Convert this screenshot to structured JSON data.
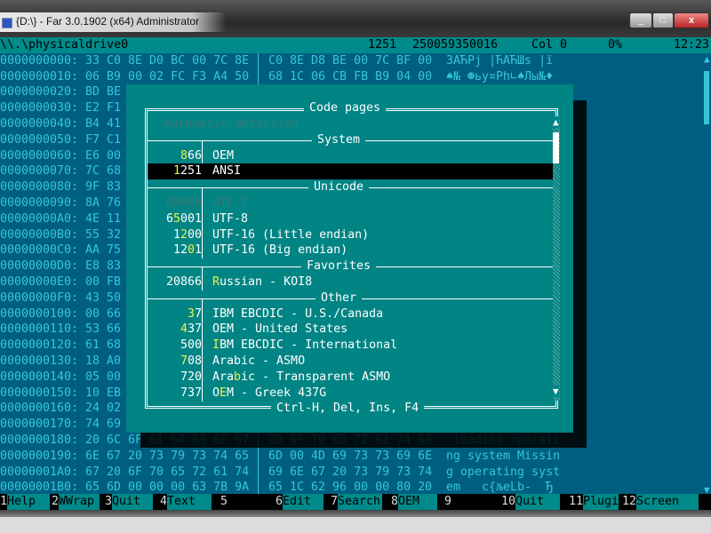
{
  "window": {
    "title": "{D:\\} - Far 3.0.1902 (x64) Administrator",
    "controls": [
      "minimize",
      "maximize",
      "close"
    ]
  },
  "status": {
    "path": "\\\\.\\physicaldrive0",
    "codepage": "1251",
    "size": "250059350016",
    "col": "Col 0",
    "percent": "0%",
    "time": "12:23"
  },
  "hex_rows": [
    {
      "offset": "0000000000:",
      "left": "33 C0 8E D0 BC 00 7C 8E",
      "right": "C0 8E D8 BE 00 7C BF 00",
      "text": "3АЋРј |ЋАЋШѕ |ї"
    },
    {
      "offset": "0000000010:",
      "left": "06 B9 00 02 FC F3 A4 50",
      "right": "68 1C 06 CB FB B9 04 00",
      "text": "♠№ ☻ьу¤Ph∟♠Лы№♦"
    },
    {
      "offset": "0000000020:",
      "left": "BD BE"
    },
    {
      "offset": "0000000030:",
      "left": "E2 F1"
    },
    {
      "offset": "0000000040:",
      "left": "B4 41"
    },
    {
      "offset": "0000000050:",
      "left": "F7 C1"
    },
    {
      "offset": "0000000060:",
      "left": "E6 00"
    },
    {
      "offset": "0000000070:",
      "left": "7C 68"
    },
    {
      "offset": "0000000080:",
      "left": "9F 83"
    },
    {
      "offset": "0000000090:",
      "left": "8A 76"
    },
    {
      "offset": "00000000A0:",
      "left": "4E 11"
    },
    {
      "offset": "00000000B0:",
      "left": "55 32"
    },
    {
      "offset": "00000000C0:",
      "left": "AA 75"
    },
    {
      "offset": "00000000D0:",
      "left": "E8 83"
    },
    {
      "offset": "00000000E0:",
      "left": "00 FB"
    },
    {
      "offset": "00000000F0:",
      "left": "43 50"
    },
    {
      "offset": "0000000100:",
      "left": "00 66"
    },
    {
      "offset": "0000000110:",
      "left": "53 66"
    },
    {
      "offset": "0000000120:",
      "left": "61 68"
    },
    {
      "offset": "0000000130:",
      "left": "18 A0"
    },
    {
      "offset": "0000000140:",
      "left": "05 00"
    },
    {
      "offset": "0000000150:",
      "left": "10 EB"
    },
    {
      "offset": "0000000160:",
      "left": "24 02"
    },
    {
      "offset": "0000000170:",
      "left": "74 69"
    },
    {
      "offset": "0000000180:",
      "left": "20 6C 6F 61 64 69 6E 67",
      "right": "20 6F 70 65 72 61 74 69",
      "text": " loading operati"
    },
    {
      "offset": "0000000190:",
      "left": "6E 67 20 73 79 73 74 65",
      "right": "6D 00 4D 69 73 73 69 6E",
      "text": "ng system Missin"
    },
    {
      "offset": "00000001A0:",
      "left": "67 20 6F 70 65 72 61 74",
      "right": "69 6E 67 20 73 79 73 74",
      "text": "g operating syst"
    },
    {
      "offset": "00000001B0:",
      "left": "65 6D 00 00 00 63 7B 9A",
      "right": "65 1C 62 96 00 00 80 20",
      "text": "em   c{љeLb-  Ђ"
    }
  ],
  "dialog": {
    "title": "Code pages",
    "auto_detect": "Automatic detection",
    "footer": "Ctrl-H, Del, Ins, F4",
    "groups": [
      {
        "label": "System",
        "items": [
          {
            "num": "866",
            "name": "OEM",
            "hot": [
              "num",
              0
            ]
          },
          {
            "num": "1251",
            "name": "ANSI",
            "hot": [
              "num",
              0
            ],
            "selected": true
          }
        ]
      },
      {
        "label": "Unicode",
        "items": [
          {
            "num": "65000",
            "name": "UTF-7",
            "disabled": true
          },
          {
            "num": "65001",
            "name": "UTF-8",
            "hot": [
              "num",
              1
            ]
          },
          {
            "num": "1200",
            "name": "UTF-16 (Little endian)",
            "hot": [
              "num",
              1
            ]
          },
          {
            "num": "1201",
            "name": "UTF-16 (Big endian)",
            "hot": [
              "num",
              2
            ]
          }
        ]
      },
      {
        "label": "Favorites",
        "items": [
          {
            "num": "20866",
            "name": "Russian - KOI8",
            "hot": [
              "name",
              0
            ]
          }
        ]
      },
      {
        "label": "Other",
        "items": [
          {
            "num": "37",
            "name": "IBM EBCDIC - U.S./Canada",
            "hot": [
              "num",
              0
            ]
          },
          {
            "num": "437",
            "name": "OEM - United States",
            "hot": [
              "num",
              0
            ]
          },
          {
            "num": "500",
            "name": "IBM EBCDIC - International",
            "hot": [
              "name",
              0
            ]
          },
          {
            "num": "708",
            "name": "Arabic - ASMO",
            "hot": [
              "num",
              0
            ]
          },
          {
            "num": "720",
            "name": "Arabic - Transparent ASMO",
            "hot": [
              "name",
              3
            ]
          },
          {
            "num": "737",
            "name": "OEM - Greek 437G",
            "hot": [
              "name",
              1
            ]
          }
        ]
      }
    ]
  },
  "keybar": [
    {
      "n": "1",
      "label": "Help"
    },
    {
      "n": "2",
      "label": "WWrap"
    },
    {
      "n": "3",
      "label": "Quit"
    },
    {
      "n": "4",
      "label": "Text"
    },
    {
      "n": "5",
      "label": ""
    },
    {
      "n": "6",
      "label": "Edit"
    },
    {
      "n": "7",
      "label": "Search"
    },
    {
      "n": "8",
      "label": "OEM"
    },
    {
      "n": "9",
      "label": ""
    },
    {
      "n": "10",
      "label": "Quit"
    },
    {
      "n": "11",
      "label": "Plugin"
    },
    {
      "n": "12",
      "label": "Screen"
    }
  ],
  "colors": {
    "viewer_bg": "#005f80",
    "viewer_text": "#35c6d6",
    "dialog_bg": "#008484",
    "hotkey": "#f0f040",
    "bar_bg": "#008a8a"
  }
}
